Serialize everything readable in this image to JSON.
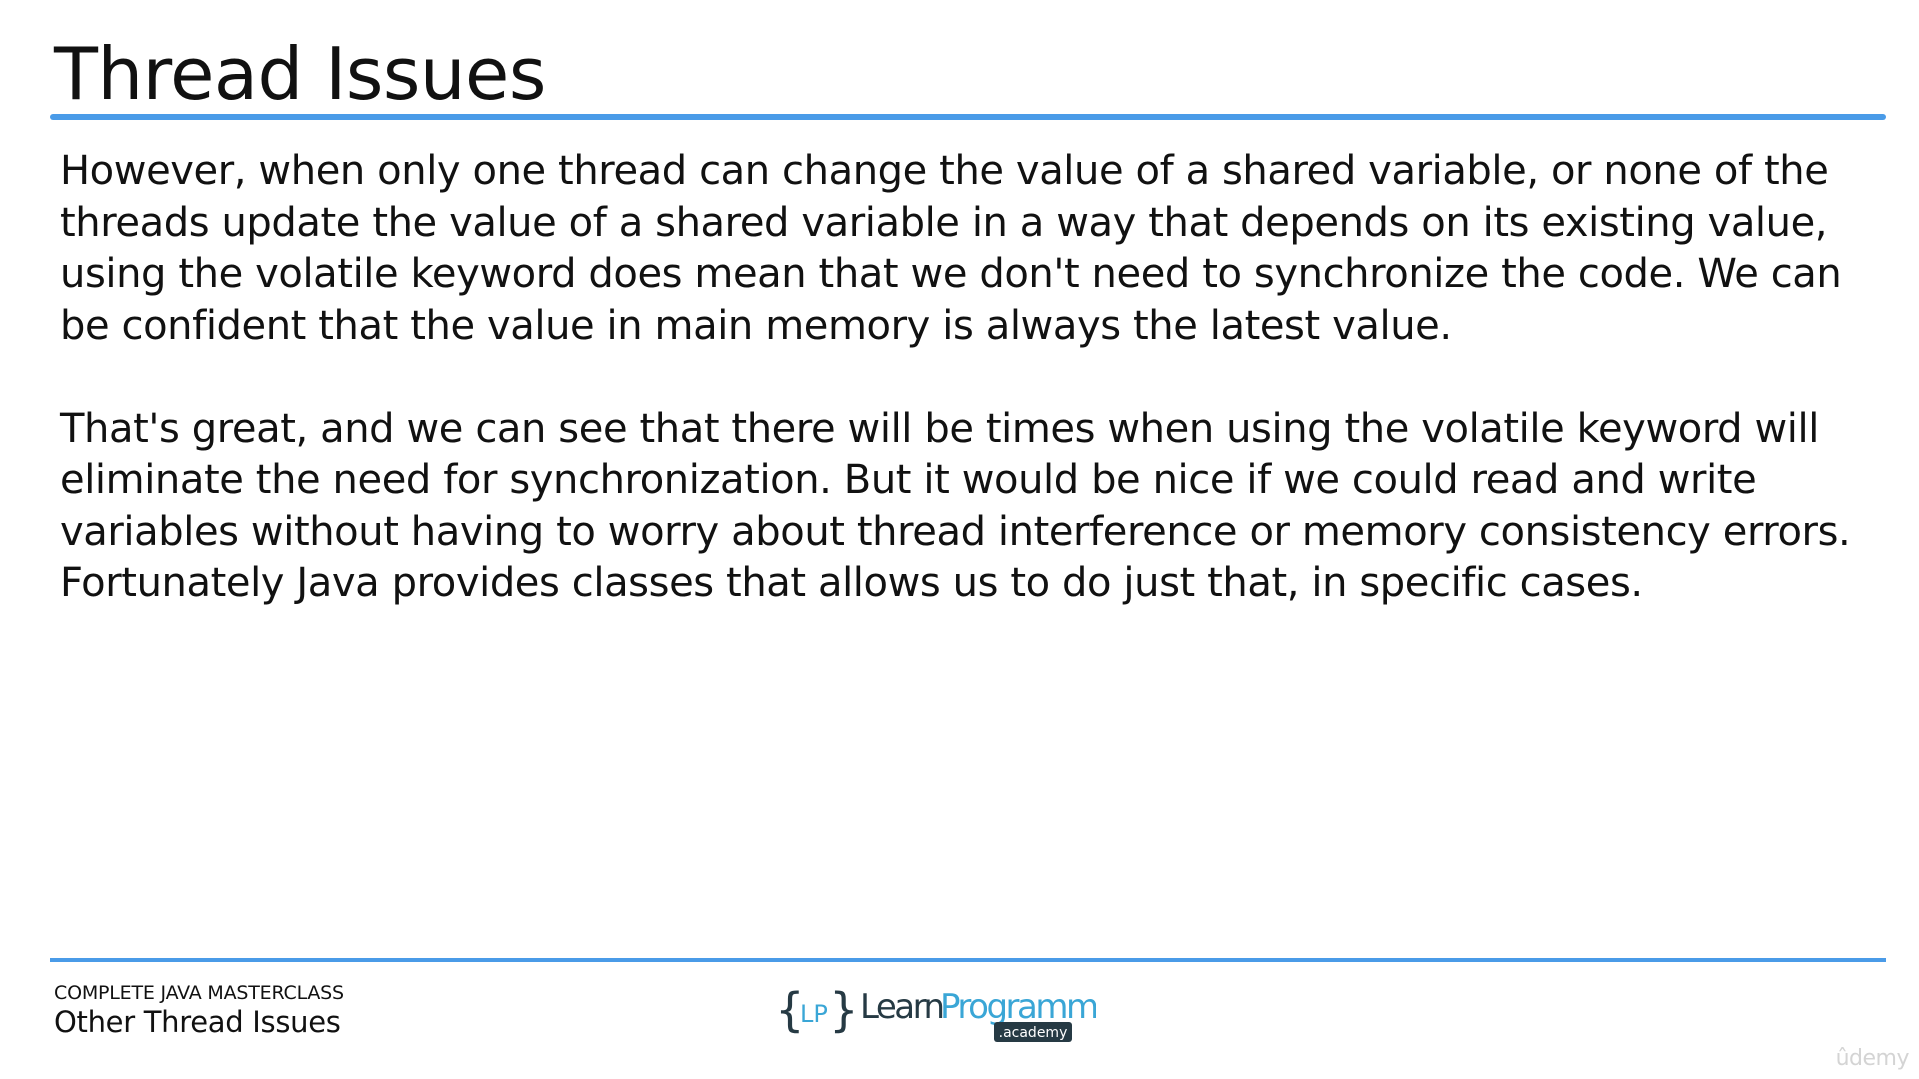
{
  "slide": {
    "title": "Thread Issues",
    "paragraphs": [
      "However, when only one thread can change the value of a shared variable, or none of the threads update the value of a shared variable in a way that depends on its existing value, using the volatile keyword does mean that we don't need to synchronize the code. We can be confident that the value in main memory is always the latest value.",
      "That's great, and we can see that there will be times when using the volatile keyword will eliminate the need for synchronization. But it would be nice if we could read and write variables without having to worry about thread interference or memory consistency errors. Fortunately Java provides classes that allows us to do just that, in specific cases."
    ]
  },
  "footer": {
    "course": "COMPLETE JAVA MASTERCLASS",
    "lesson": "Other Thread Issues"
  },
  "logo": {
    "mark": "LP",
    "brand_learn": "Learn",
    "brand_programming": "Programming",
    "badge": ".academy"
  },
  "watermark": "ûdemy",
  "colors": {
    "accent": "#4a9be8",
    "text": "#111111",
    "logo_dark": "#263a44",
    "logo_blue": "#3aa6d6"
  }
}
